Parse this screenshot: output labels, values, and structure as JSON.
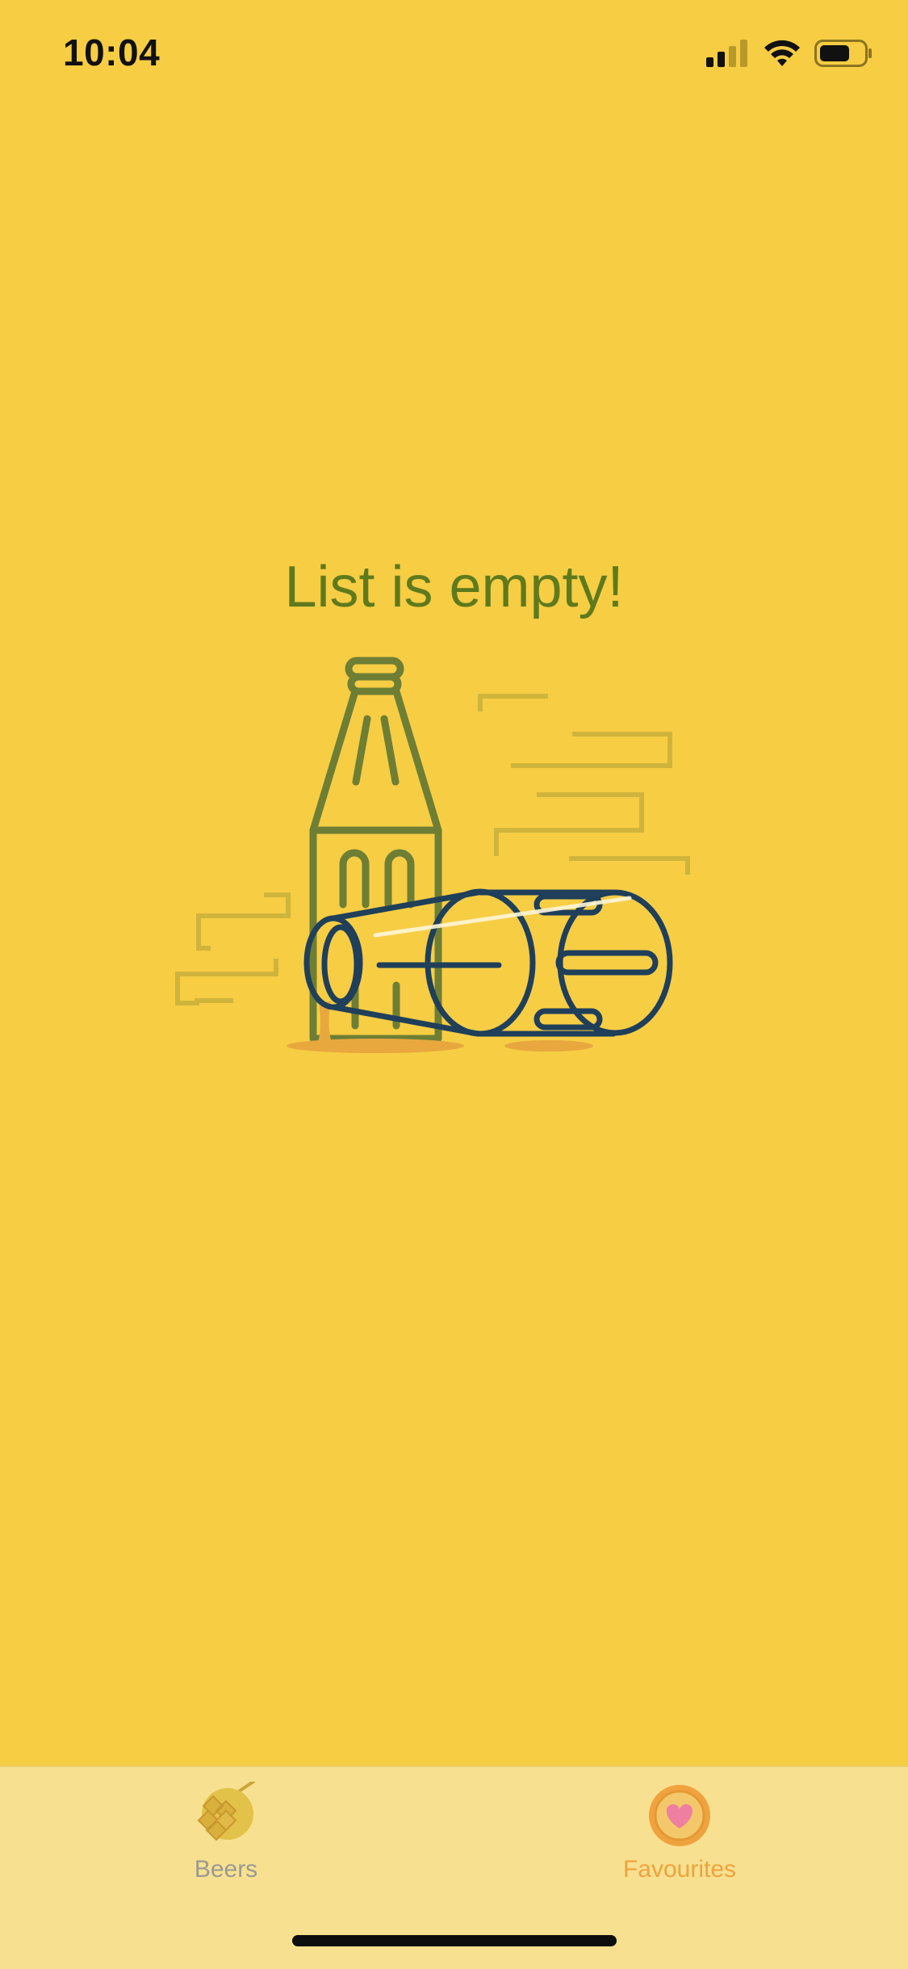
{
  "status_bar": {
    "time": "10:04"
  },
  "empty_state": {
    "title": "List is empty!"
  },
  "tab_bar": {
    "tabs": [
      {
        "label": "Beers",
        "icon": "hop-icon",
        "selected": false
      },
      {
        "label": "Favourites",
        "icon": "bottle-cap-heart-icon",
        "selected": true
      }
    ]
  },
  "colors": {
    "background": "#F7CD44",
    "title": "#5E7A1C",
    "tab_bar": "#F7E190",
    "tab_active": "#F0A23E",
    "tab_inactive": "#9A9A93"
  }
}
